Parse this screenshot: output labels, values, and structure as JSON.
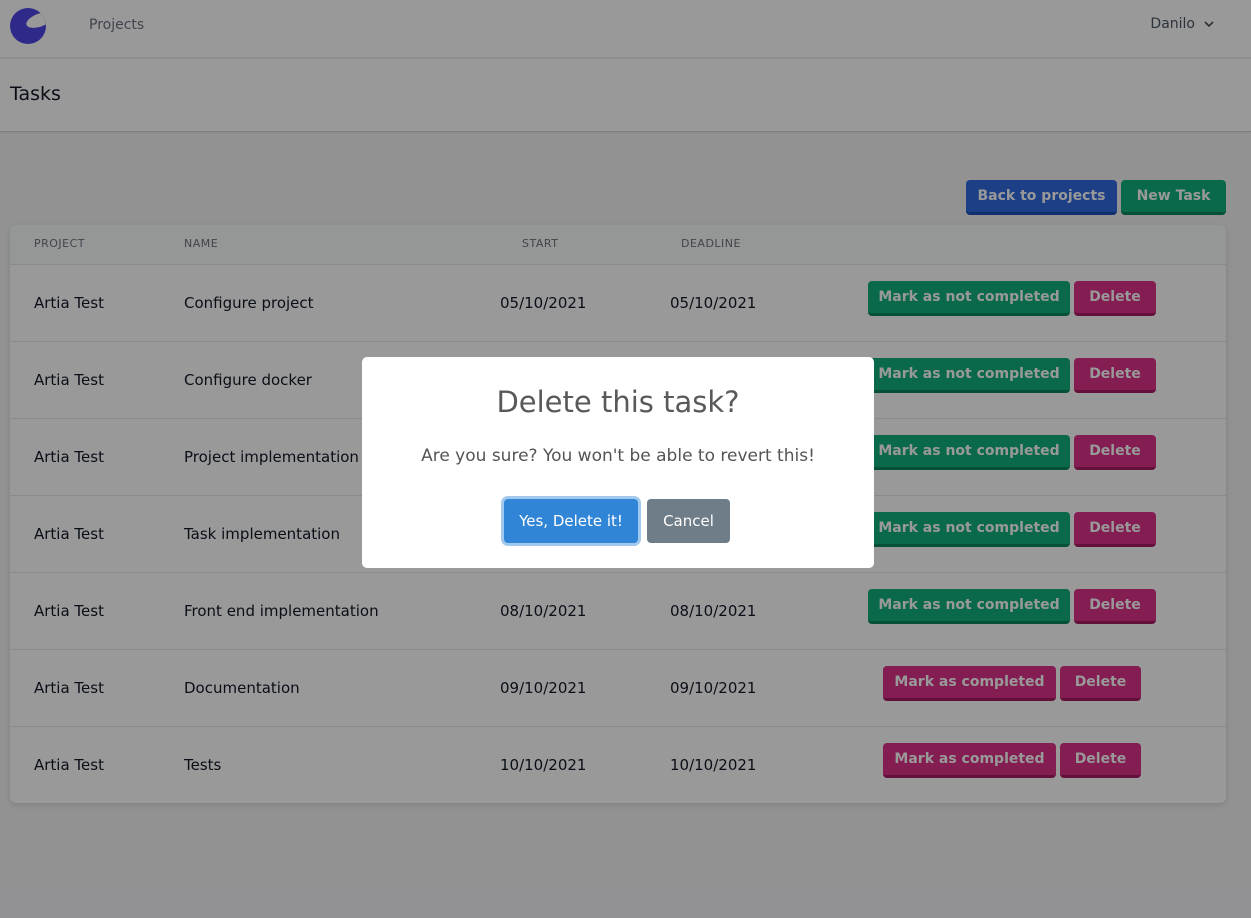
{
  "navbar": {
    "projects_link": "Projects",
    "user_name": "Danilo"
  },
  "header": {
    "title": "Tasks"
  },
  "actions": {
    "back_label": "Back to projects",
    "new_label": "New Task"
  },
  "table": {
    "columns": [
      "PROJECT",
      "NAME",
      "START",
      "DEADLINE"
    ],
    "rows": [
      {
        "project": "Artia Test",
        "name": "Configure project",
        "start": "05/10/2021",
        "deadline": "05/10/2021",
        "toggle_label": "Mark as not completed",
        "delete_label": "Delete",
        "completed": true
      },
      {
        "project": "Artia Test",
        "name": "Configure docker",
        "start": "",
        "deadline": "",
        "toggle_label": "Mark as not completed",
        "delete_label": "Delete",
        "completed": true
      },
      {
        "project": "Artia Test",
        "name": "Project implementation",
        "start": "",
        "deadline": "",
        "toggle_label": "Mark as not completed",
        "delete_label": "Delete",
        "completed": true
      },
      {
        "project": "Artia Test",
        "name": "Task implementation",
        "start": "",
        "deadline": "",
        "toggle_label": "Mark as not completed",
        "delete_label": "Delete",
        "completed": true
      },
      {
        "project": "Artia Test",
        "name": "Front end implementation",
        "start": "08/10/2021",
        "deadline": "08/10/2021",
        "toggle_label": "Mark as not completed",
        "delete_label": "Delete",
        "completed": true
      },
      {
        "project": "Artia Test",
        "name": "Documentation",
        "start": "09/10/2021",
        "deadline": "09/10/2021",
        "toggle_label": "Mark as completed",
        "delete_label": "Delete",
        "completed": false
      },
      {
        "project": "Artia Test",
        "name": "Tests",
        "start": "10/10/2021",
        "deadline": "10/10/2021",
        "toggle_label": "Mark as completed",
        "delete_label": "Delete",
        "completed": false
      }
    ]
  },
  "modal": {
    "title": "Delete this task?",
    "text": "Are you sure? You won't be able to revert this!",
    "confirm_label": "Yes, Delete it!",
    "cancel_label": "Cancel"
  },
  "colors": {
    "primary": "#2f6ae0",
    "success": "#0fb07c",
    "danger": "#dd3187",
    "confirm": "#3085d6",
    "cancel": "#6e7d88"
  },
  "icons": {
    "logo": "logo-icon",
    "user_menu": "chevron-down-icon"
  }
}
